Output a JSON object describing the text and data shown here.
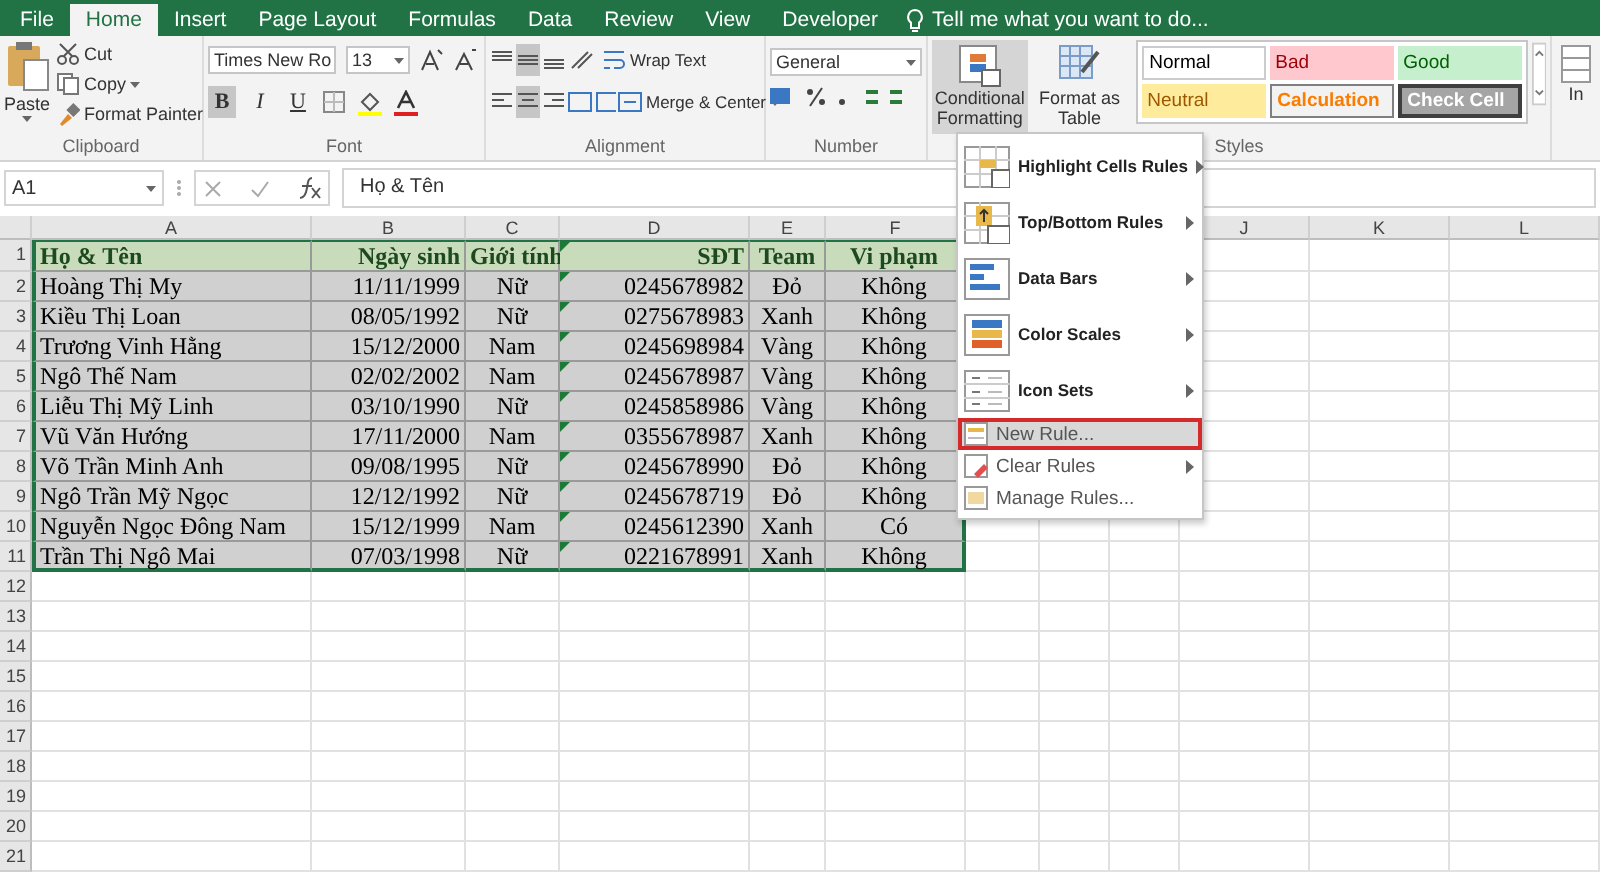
{
  "ribbon_tabs": [
    {
      "label": "File",
      "selected": false
    },
    {
      "label": "Home",
      "selected": true
    },
    {
      "label": "Insert",
      "selected": false
    },
    {
      "label": "Page Layout",
      "selected": false
    },
    {
      "label": "Formulas",
      "selected": false
    },
    {
      "label": "Data",
      "selected": false
    },
    {
      "label": "Review",
      "selected": false
    },
    {
      "label": "View",
      "selected": false
    },
    {
      "label": "Developer",
      "selected": false
    }
  ],
  "tell_me": {
    "placeholder": "Tell me what you want to do..."
  },
  "clipboard": {
    "paste": "Paste",
    "cut": "Cut",
    "copy": "Copy",
    "format_painter": "Format Painter",
    "label": "Clipboard"
  },
  "font": {
    "name": "Times New Ro",
    "size": "13",
    "label": "Font",
    "styles": [
      {
        "label": "B",
        "selected": true
      },
      {
        "label": "I",
        "selected": false
      },
      {
        "label": "U",
        "selected": false
      }
    ]
  },
  "alignment": {
    "label": "Alignment",
    "wrap_text": "Wrap Text",
    "merge_center": "Merge & Center",
    "vertical": [
      {
        "selected": false
      },
      {
        "selected": true
      },
      {
        "selected": false
      }
    ],
    "horizontal": [
      {
        "selected": false
      },
      {
        "selected": true
      },
      {
        "selected": false
      }
    ]
  },
  "number": {
    "format": "General",
    "label": "Number"
  },
  "styles": {
    "label": "Styles",
    "conditional_formatting": {
      "label": "Conditional Formatting",
      "selected": true
    },
    "format_as_table": "Format as Table",
    "gallery": [
      {
        "label": "Normal",
        "kind": "normal"
      },
      {
        "label": "Bad",
        "kind": "bad"
      },
      {
        "label": "Good",
        "kind": "good"
      },
      {
        "label": "Neutral",
        "kind": "neutral"
      },
      {
        "label": "Calculation",
        "kind": "calculation"
      },
      {
        "label": "Check Cell",
        "kind": "check"
      }
    ]
  },
  "cells": {
    "insert": "In"
  },
  "formula_bar": {
    "name_box": "A1",
    "formula": "Họ & Tên"
  },
  "columns": [
    "A",
    "B",
    "C",
    "D",
    "E",
    "F",
    "J",
    "K",
    "L"
  ],
  "header": {
    "number": "1",
    "cells": [
      "Họ & Tên",
      "Ngày sinh",
      "Giới tính",
      "SĐT",
      "Team",
      "Vi phạm"
    ],
    "number_as_text": true
  },
  "rows": [
    {
      "number": "2",
      "cells": [
        "Hoàng Thị My",
        "11/11/1999",
        "Nữ",
        "0245678982",
        "Đỏ",
        "Không"
      ],
      "number_as_text": true
    },
    {
      "number": "3",
      "cells": [
        "Kiều Thị Loan",
        "08/05/1992",
        "Nữ",
        "0275678983",
        "Xanh",
        "Không"
      ],
      "number_as_text": true
    },
    {
      "number": "4",
      "cells": [
        "Trương Vinh Hằng",
        "15/12/2000",
        "Nam",
        "0245698984",
        "Vàng",
        "Không"
      ],
      "number_as_text": true
    },
    {
      "number": "5",
      "cells": [
        "Ngô Thế Nam",
        "02/02/2002",
        "Nam",
        "0245678987",
        "Vàng",
        "Không"
      ],
      "number_as_text": true
    },
    {
      "number": "6",
      "cells": [
        "Liễu Thị Mỹ Linh",
        "03/10/1990",
        "Nữ",
        "0245858986",
        "Vàng",
        "Không"
      ],
      "number_as_text": true
    },
    {
      "number": "7",
      "cells": [
        "Vũ Văn Hướng",
        "17/11/2000",
        "Nam",
        "0355678987",
        "Xanh",
        "Không"
      ],
      "number_as_text": true
    },
    {
      "number": "8",
      "cells": [
        "Võ Trần Minh Anh",
        "09/08/1995",
        "Nữ",
        "0245678990",
        "Đỏ",
        "Không"
      ],
      "number_as_text": true
    },
    {
      "number": "9",
      "cells": [
        "Ngô Trần Mỹ Ngọc",
        "12/12/1992",
        "Nữ",
        "0245678719",
        "Đỏ",
        "Không"
      ],
      "number_as_text": true
    },
    {
      "number": "10",
      "cells": [
        "Nguyễn Ngọc Đông Nam",
        "15/12/1999",
        "Nam",
        "0245612390",
        "Xanh",
        "Có"
      ],
      "number_as_text": true
    },
    {
      "number": "11",
      "cells": [
        "Trần Thị Ngô Mai",
        "07/03/1998",
        "Nữ",
        "0221678991",
        "Xanh",
        "Không"
      ],
      "number_as_text": true
    }
  ],
  "empty_rows": [
    "12",
    "13",
    "14",
    "15",
    "16",
    "17",
    "18",
    "19",
    "20",
    "21"
  ],
  "cf_menu": [
    {
      "label": "Highlight Cells Rules",
      "kind": "large",
      "submenu": true,
      "selected": false
    },
    {
      "label": "Top/Bottom Rules",
      "kind": "large",
      "submenu": true,
      "selected": false
    },
    {
      "label": "Data Bars",
      "kind": "large",
      "submenu": true,
      "selected": false
    },
    {
      "label": "Color Scales",
      "kind": "large",
      "submenu": true,
      "selected": false
    },
    {
      "label": "Icon Sets",
      "kind": "large",
      "submenu": true,
      "selected": false
    },
    {
      "label": "New Rule...",
      "kind": "small",
      "submenu": false,
      "selected": true
    },
    {
      "label": "Clear Rules",
      "kind": "small",
      "submenu": true,
      "selected": false
    },
    {
      "label": "Manage Rules...",
      "kind": "small",
      "submenu": false,
      "selected": false
    }
  ]
}
